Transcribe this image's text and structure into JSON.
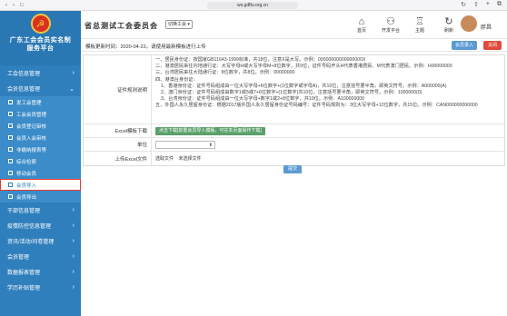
{
  "browser": {
    "url": "ws.gdftu.org.cn",
    "buttons": [
      "‹",
      "›",
      "□"
    ],
    "right_icons": [
      "↻",
      "⇧",
      "+",
      "⧉"
    ]
  },
  "sidebar": {
    "brand_name_line1": "广东工会会员实名制",
    "brand_name_line2": "服务平台",
    "items": [
      {
        "label": "工会信息管理",
        "type": "group"
      },
      {
        "label": "会员信息管理",
        "type": "group-open"
      }
    ],
    "sub_items": [
      {
        "label": "发工会管理"
      },
      {
        "label": "工会会员管理"
      },
      {
        "label": "会员登记审核"
      },
      {
        "label": "会员入会审核"
      },
      {
        "label": "非缴纳报表等"
      },
      {
        "label": "综合检索"
      },
      {
        "label": "移动会员"
      },
      {
        "label": "会员导入"
      },
      {
        "label": "会员导出"
      }
    ],
    "items_after": [
      {
        "label": "干部信息管理"
      },
      {
        "label": "疫情防控信息管理"
      },
      {
        "label": "资讯/活动/问卷管理"
      },
      {
        "label": "会员管理"
      },
      {
        "label": "数据报表管理"
      },
      {
        "label": "学历补贴管理"
      }
    ]
  },
  "header": {
    "site_title": "省总测试工会委员会",
    "switch_label": "切换工会 ▾",
    "nav": [
      {
        "label": "首页",
        "icon": "home-icon",
        "glyph": "⌂"
      },
      {
        "label": "开发平台",
        "icon": "handshake-icon",
        "glyph": "⚇"
      },
      {
        "label": "主题",
        "icon": "shirt-icon",
        "glyph": "♖"
      },
      {
        "label": "刷新",
        "icon": "refresh-icon",
        "glyph": "↻"
      }
    ],
    "user_name": "胖昌"
  },
  "main": {
    "notice": "模板更新时间：2020-04-22。请使用最新模板进行上传",
    "import_button": "会员录入",
    "close_button": "关闭",
    "rules_label": "证件规则说明",
    "rules": [
      {
        "text": "一、居民身份证：按国家GB11643-1999标准，共18位，注意X是大写。示例：00000000000000000X",
        "indent": false
      },
      {
        "text": "二、港澳居民来往内地通行证：大写字母H或大写字母M+8位数字，共9位，证件号码开头H代表香港居民、M代表澳门居民。示例：H00000000",
        "indent": false
      },
      {
        "text": "三、台湾居民来往大陆通行证：8位数字，共8位。示例：00000000",
        "indent": false
      },
      {
        "text": "四、港澳台身份证：",
        "indent": false
      },
      {
        "text": "1、香港身份证：证件号码组成由一位大写字母+6位数字+(1位数字或字母A)，共10位，注意括号要半角，即英文符号。示例：A000000(A)",
        "indent": true
      },
      {
        "text": "2、澳门身份证：证件号码组成由数字1或5或7+6位数字+(1位数字)共10位，注意括号要半角，即英文符号。示例：1000000(0)",
        "indent": true
      },
      {
        "text": "3、台湾身份证：证件号码组成由一位大写字母+数字1或2+8位数字，共10位。示例：A100000000",
        "indent": true
      },
      {
        "text": "五、外国人永久居留身份证：根据2017版外国人永久居留身份证号码编号：证件号码规则为：3位大写字母+12位数字，共15位。示例：CAN000000000000",
        "indent": false
      }
    ],
    "excel_label": "Excel模板下载",
    "excel_button": "点击下载[前置会员导入模版，可在本页面操作下载]",
    "unit_label": "单位",
    "upload_label": "上传Excel文件",
    "file_button": "选取文件",
    "file_status": "未选择文件",
    "submit_button": "提交"
  }
}
